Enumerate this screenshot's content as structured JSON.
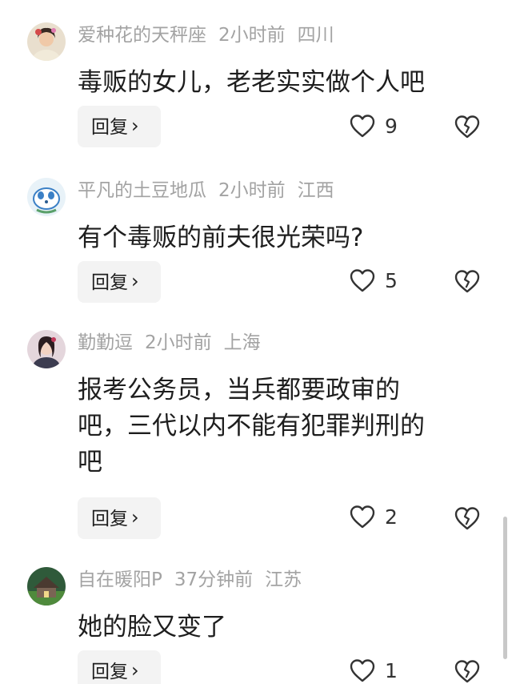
{
  "comments": [
    {
      "username": "爱种花的天秤座",
      "time": "2小时前",
      "location": "四川",
      "text": "毒贩的女儿，老老实实做个人吧",
      "reply_label": "回复",
      "likes": "9"
    },
    {
      "username": "平凡的土豆地瓜",
      "time": "2小时前",
      "location": "江西",
      "text": "有个毒贩的前夫很光荣吗?",
      "reply_label": "回复",
      "likes": "5"
    },
    {
      "username": "勤勤逗",
      "time": "2小时前",
      "location": "上海",
      "text": "报考公务员，当兵都要政审的\n吧，三代以内不能有犯罪判刑的\n吧",
      "reply_label": "回复",
      "likes": "2"
    },
    {
      "username": "自在暖阳P",
      "time": "37分钟前",
      "location": "江苏",
      "text": "她的脸又变了",
      "reply_label": "回复",
      "likes": "1"
    }
  ],
  "icons": {
    "like": "heart-outline-icon",
    "dislike": "broken-heart-icon",
    "reply_chevron": "chevron-right-icon"
  },
  "colors": {
    "meta_text": "#a3a3a3",
    "body_text": "#1e1e1e",
    "button_bg": "#f3f3f3"
  }
}
